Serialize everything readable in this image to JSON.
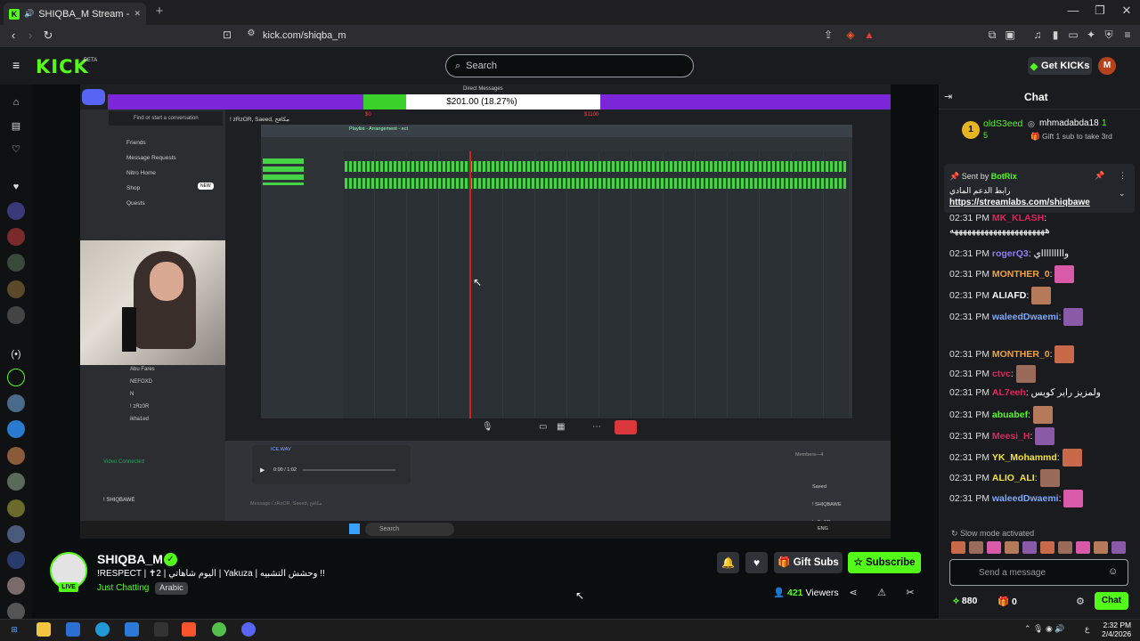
{
  "browser": {
    "tab_title": "SHIQBA_M Stream - Watch Li",
    "tab_close": "✕",
    "url": "kick.com/shiqba_m"
  },
  "header": {
    "logo": "KICK",
    "logo_badge": "BETA",
    "search_placeholder": "Search",
    "get_kicks": "Get KICKs",
    "user_initial": "M"
  },
  "video": {
    "goal_text": "$201.00 (18.27%)",
    "goal_progress": 0.1827,
    "goal_left_amount": "$0",
    "goal_right_amount": "$1100",
    "discord_dm_title": "Direct Messages",
    "discord_find": "Find or start a conversation",
    "discord_nav": [
      "Friends",
      "Message Requests",
      "Nitro Home",
      "Shop",
      "Quests"
    ],
    "discord_shop_badge": "NEW",
    "daw_playlist": "Playlist - Arrangement - ect",
    "call_group": "! zRzOR, Saeed, مكافح",
    "video_connected": "Video Connected",
    "dm_users": [
      "Abu Fares",
      "NEFOXD",
      "N",
      "! zRz0R",
      "ikha1ed"
    ],
    "local_user": "! SHIQBAWE",
    "members_label": "Members—4",
    "member_names": [
      "Saeed",
      "! SHIQBAWE",
      "! zRzOR"
    ],
    "taskbar_search": "Search",
    "file_name": "ICE.WAV",
    "file_time": "0:00 / 1:02",
    "lang": "ENG",
    "message_placeholder": "Message / zRzOR, Saeed, مكافح"
  },
  "stream": {
    "streamer": "SHIQBA_M",
    "live_badge": "LIVE",
    "title": "!RESPECT | ✝2 | اليوم شاهاتي | Yakuza | وحشش التشبيه !!",
    "category": "Just Chatting",
    "tag": "Arabic",
    "gift_subs": "Gift Subs",
    "subscribe": "Subscribe",
    "viewers_count": "421",
    "viewers_label": "Viewers"
  },
  "chat": {
    "title": "Chat",
    "gifter": {
      "rank": "1",
      "name": "oldS3eed",
      "count": "5",
      "second_name": "mhmadabda18",
      "second_count": "1",
      "gift_text": "Gift 1 sub to take 3rd"
    },
    "pinned": {
      "sent_by_label": "Sent by",
      "sender": "BotRix",
      "text": "رابط الدعم المادي",
      "link": "https://streamlabs.com/shiqbawe"
    },
    "messages": [
      {
        "time": "02:31 PM",
        "user": "MK_KLASH",
        "color": "#e0245e",
        "text": "ههههههههههههههههههههههه"
      },
      {
        "time": "02:31 PM",
        "user": "rogerQ3",
        "color": "#8e7cff",
        "text": "واااااااااي"
      },
      {
        "time": "02:31 PM",
        "user": "MONTHER_0",
        "color": "#f2a33a",
        "text": ""
      },
      {
        "time": "02:31 PM",
        "user": "ALIAFD",
        "color": "#ffffff",
        "text": ""
      },
      {
        "time": "02:31 PM",
        "user": "waleedDwaemi",
        "color": "#7da8ff",
        "text": ""
      },
      {
        "time": "02:31 PM",
        "user": "MONTHER_0",
        "color": "#f2a33a",
        "text": ""
      },
      {
        "time": "02:31 PM",
        "user": "ctvc",
        "color": "#e0245e",
        "text": ""
      },
      {
        "time": "02:31 PM",
        "user": "AL7eeh",
        "color": "#e0245e",
        "text": "ولمزيز راير كويس"
      },
      {
        "time": "02:31 PM",
        "user": "abuabef",
        "color": "#53fc18",
        "text": ""
      },
      {
        "time": "02:31 PM",
        "user": "Meesi_H",
        "color": "#e0245e",
        "text": ""
      },
      {
        "time": "02:31 PM",
        "user": "YK_Mohammd",
        "color": "#f2e33a",
        "text": ""
      },
      {
        "time": "02:31 PM",
        "user": "ALIO_ALI",
        "color": "#f2e33a",
        "text": ""
      },
      {
        "time": "02:31 PM",
        "user": "waleedDwaemi",
        "color": "#7da8ff",
        "text": ""
      }
    ],
    "slow_mode": "Slow mode activated",
    "input_placeholder": "Send a message",
    "points": "880",
    "gift_count": "0",
    "chat_button": "Chat"
  },
  "taskbar": {
    "time": "2:32 PM",
    "date": "2/4/2026",
    "lang": "ع"
  },
  "colors": {
    "brand": "#53fc18",
    "background": "#0b0e0f",
    "panel": "#191b1f",
    "goal_bar": "#7c26d9"
  }
}
